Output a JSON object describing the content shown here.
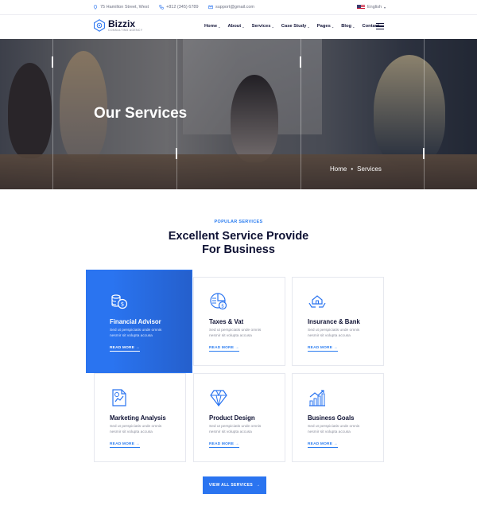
{
  "topbar": {
    "address": "75 Hamilton Street, West",
    "phone": "+812 (345) 6789",
    "email": "support@gmail.com",
    "language": "English"
  },
  "brand": {
    "name": "Bizzix",
    "tagline": "CONSULTING AGENCY"
  },
  "nav": {
    "items": [
      {
        "label": "Home",
        "dropdown": true
      },
      {
        "label": "About",
        "dropdown": true
      },
      {
        "label": "Services",
        "dropdown": true
      },
      {
        "label": "Case Study",
        "dropdown": true
      },
      {
        "label": "Pages",
        "dropdown": true
      },
      {
        "label": "Blog",
        "dropdown": true
      },
      {
        "label": "Contact",
        "dropdown": false
      }
    ]
  },
  "hero": {
    "title": "Our Services",
    "breadcrumb": {
      "home": "Home",
      "separator": "•",
      "current": "Services"
    }
  },
  "section": {
    "eyebrow": "POPULAR SERVICES",
    "heading_line1": "Excellent Service Provide",
    "heading_line2": "For Business"
  },
  "services": [
    {
      "title": "Financial Advisor",
      "desc": "Sed ut perspiciatis unde omnis nesmir sit volupta accusa",
      "more": "READ MORE",
      "icon": "coins-icon"
    },
    {
      "title": "Taxes & Vat",
      "desc": "Sed ut perspiciatis unde omnis nesmir sit volupta accusa",
      "more": "READ MORE",
      "icon": "tax-chart-icon"
    },
    {
      "title": "Insurance & Bank",
      "desc": "Sed ut perspiciatis unde omnis nesmir sit volupta accusa",
      "more": "READ MORE",
      "icon": "house-hands-icon"
    },
    {
      "title": "Marketing Analysis",
      "desc": "Sed ut perspiciatis unde omnis nesmir sit volupta accusa",
      "more": "READ MORE",
      "icon": "analysis-report-icon"
    },
    {
      "title": "Product Design",
      "desc": "Sed ut perspiciatis unde omnis nesmir sit volupta accusa",
      "more": "READ MORE",
      "icon": "diamond-icon"
    },
    {
      "title": "Business Goals",
      "desc": "Sed ut perspiciatis unde omnis nesmir sit volupta accusa",
      "more": "READ MORE",
      "icon": "growth-chart-icon"
    }
  ],
  "cta": {
    "label": "VIEW ALL SERVICES"
  },
  "colors": {
    "accent": "#2a74f0",
    "heading": "#0e1133",
    "muted": "#8a8d9b"
  }
}
